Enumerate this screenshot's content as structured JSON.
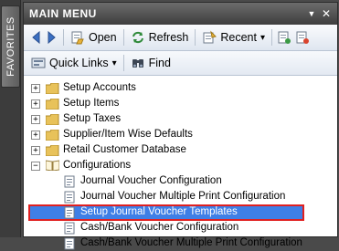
{
  "favorites_tab": "FAVORITES",
  "window": {
    "title": "MAIN MENU",
    "pin_glyph": "▼",
    "close_glyph": "✕"
  },
  "toolbar": {
    "open": "Open",
    "refresh": "Refresh",
    "recent": "Recent",
    "recent_arrow": "▾"
  },
  "toolbar2": {
    "quick_links": "Quick Links",
    "quick_arrow": "▾",
    "find": "Find"
  },
  "tree": [
    {
      "label": "Setup Accounts",
      "expander": "+",
      "type": "folder"
    },
    {
      "label": "Setup Items",
      "expander": "+",
      "type": "folder"
    },
    {
      "label": "Setup Taxes",
      "expander": "+",
      "type": "folder"
    },
    {
      "label": "Supplier/Item Wise Defaults",
      "expander": "+",
      "type": "folder"
    },
    {
      "label": "Retail Customer Database",
      "expander": "+",
      "type": "folder"
    },
    {
      "label": "Configurations",
      "expander": "−",
      "type": "folder-open"
    },
    {
      "label": "Journal Voucher Configuration",
      "type": "doc"
    },
    {
      "label": "Journal Voucher Multiple Print Configuration",
      "type": "doc"
    },
    {
      "label": "Setup Journal Voucher Templates",
      "type": "doc",
      "selected": true
    },
    {
      "label": "Cash/Bank Voucher Configuration",
      "type": "doc"
    },
    {
      "label": "Cash/Bank Voucher Multiple Print Configuration",
      "type": "doc"
    }
  ],
  "colors": {
    "selection": "#3f7fe6",
    "highlight_border": "#e02020",
    "folder": "#e8c25a"
  }
}
